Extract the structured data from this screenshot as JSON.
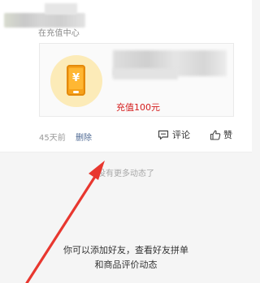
{
  "post": {
    "source": "在充值中心",
    "product_price": "充值100元",
    "product_icon_symbol": "¥",
    "time_ago": "45天前",
    "delete_label": "删除",
    "comment_label": "评论",
    "like_label": "赞"
  },
  "feed": {
    "no_more_text": "没有更多动态了",
    "empty_hint_line1": "你可以添加好友，查看好友拼单",
    "empty_hint_line2": "和商品评价动态"
  },
  "colors": {
    "price_red": "#d41c1c",
    "link_blue": "#4f6a94",
    "annotation_arrow": "#e8372f",
    "icon_bg": "#fcebb8",
    "phone_orange": "#f6a21b"
  },
  "icons": {
    "comment": "comment-bubble-icon",
    "like": "thumbs-up-icon",
    "product": "phone-recharge-icon"
  }
}
